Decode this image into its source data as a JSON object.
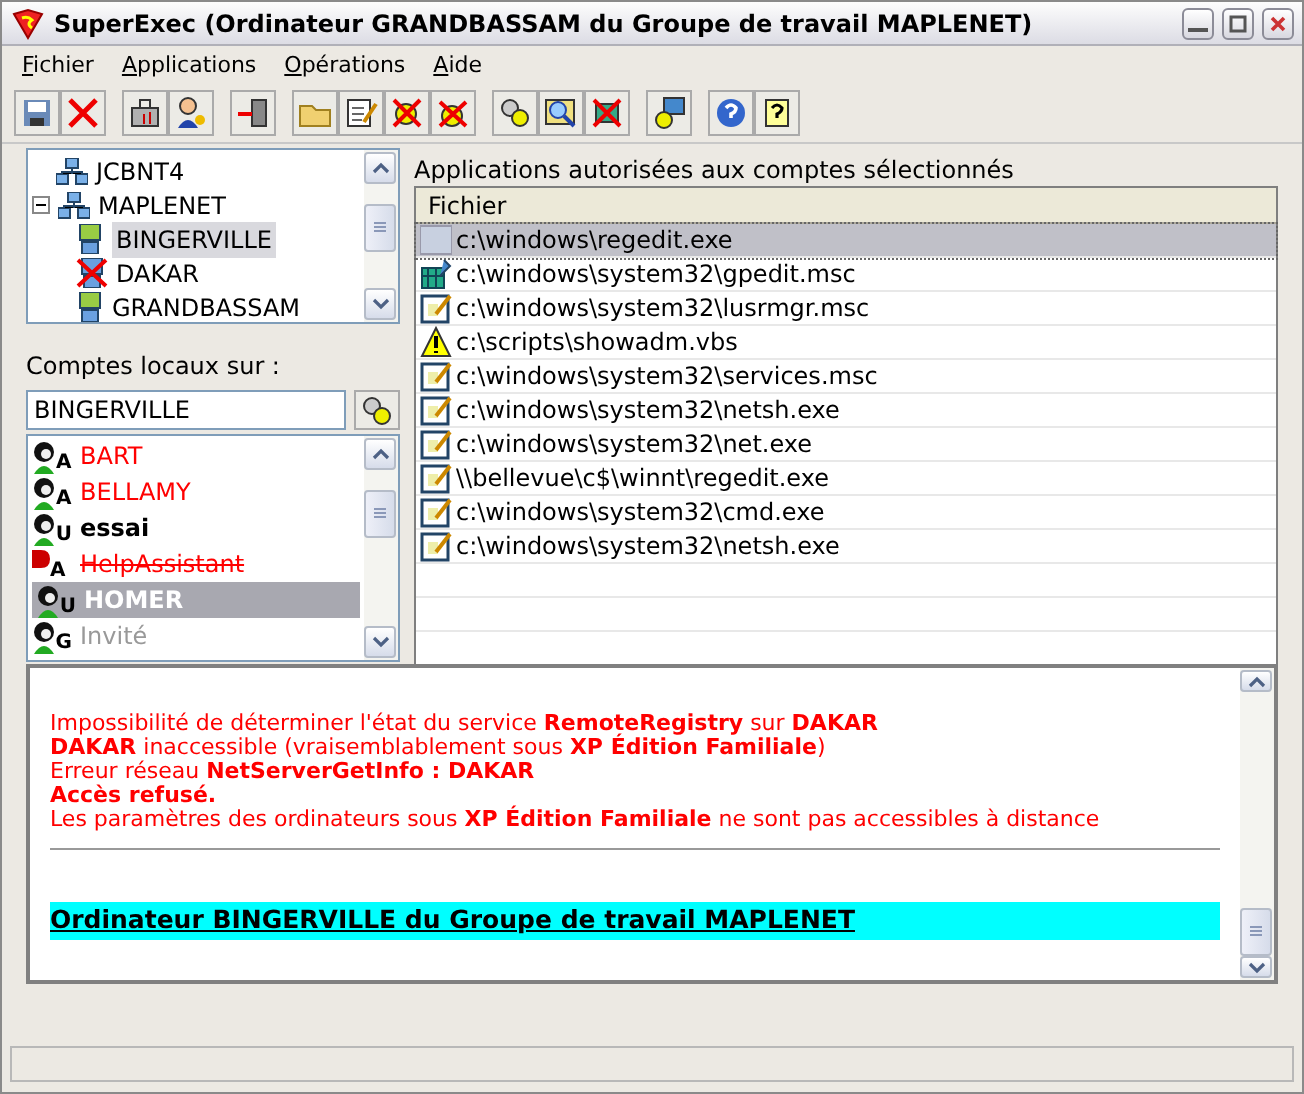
{
  "window": {
    "title": "SuperExec (Ordinateur GRANDBASSAM du Groupe de travail MAPLENET)"
  },
  "menu": [
    "Fichier",
    "Applications",
    "Opérations",
    "Aide"
  ],
  "tree": [
    {
      "label": "JCBNT4",
      "kind": "workgroup"
    },
    {
      "label": "MAPLENET",
      "kind": "workgroup",
      "expanded": true,
      "children": [
        {
          "label": "BINGERVILLE",
          "kind": "computer",
          "selected": true
        },
        {
          "label": "DAKAR",
          "kind": "computer-error",
          "selected": false
        },
        {
          "label": "GRANDBASSAM",
          "kind": "computer",
          "selected": false
        }
      ]
    }
  ],
  "accounts_label": "Comptes locaux sur :",
  "computer_field": {
    "value": "BINGERVILLE"
  },
  "accounts": [
    {
      "name": "BART",
      "role": "A",
      "kind": "admin",
      "selected": false
    },
    {
      "name": "BELLAMY",
      "role": "A",
      "kind": "admin",
      "selected": false
    },
    {
      "name": "essai",
      "role": "U",
      "kind": "user",
      "selected": false
    },
    {
      "name": "HelpAssistant",
      "role": "A",
      "kind": "disabled",
      "selected": false
    },
    {
      "name": "HOMER",
      "role": "U",
      "kind": "user",
      "selected": true
    },
    {
      "name": "Invité",
      "role": "G",
      "kind": "guest",
      "selected": false
    }
  ],
  "apps_label": "Applications autorisées aux comptes sélectionnés",
  "apps_table": {
    "columns": [
      "Fichier"
    ],
    "rows": [
      {
        "path": "c:\\windows\\regedit.exe",
        "kind": "generic",
        "selected": true
      },
      {
        "path": "c:\\windows\\system32\\gpedit.msc",
        "kind": "snapin",
        "selected": false
      },
      {
        "path": "c:\\windows\\system32\\lusrmgr.msc",
        "kind": "edit",
        "selected": false
      },
      {
        "path": "c:\\scripts\\showadm.vbs",
        "kind": "warning",
        "selected": false
      },
      {
        "path": "c:\\windows\\system32\\services.msc",
        "kind": "edit",
        "selected": false
      },
      {
        "path": "c:\\windows\\system32\\netsh.exe",
        "kind": "edit",
        "selected": false
      },
      {
        "path": "c:\\windows\\system32\\net.exe",
        "kind": "edit",
        "selected": false
      },
      {
        "path": "\\\\bellevue\\c$\\winnt\\regedit.exe",
        "kind": "edit",
        "selected": false
      },
      {
        "path": "c:\\windows\\system32\\cmd.exe",
        "kind": "edit",
        "selected": false
      },
      {
        "path": "c:\\windows\\system32\\netsh.exe",
        "kind": "edit",
        "selected": false
      }
    ]
  },
  "log": {
    "messages": [
      "Impossibilité de déterminer l'état du service **RemoteRegistry** sur **DAKAR**",
      "**DAKAR** inaccessible (vraisemblablement sous **XP Édition Familiale**)",
      "Erreur réseau **NetServerGetInfo : DAKAR**",
      "**Accès refusé.**",
      "Les paramètres des ordinateurs sous **XP Édition Familiale** ne sont pas accessibles à distance"
    ],
    "heading": "Ordinateur BINGERVILLE du Groupe de travail MAPLENET"
  }
}
